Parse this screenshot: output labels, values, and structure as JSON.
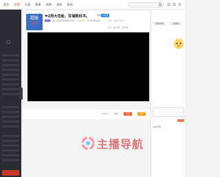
{
  "nav": {
    "items": [
      "首页",
      "直播",
      "分类",
      "赛事",
      "视频",
      "游戏",
      "鱼吧"
    ],
    "active_index": 1
  },
  "search": {
    "placeholder": ""
  },
  "room": {
    "title": "❤2周大花脸，写填数科书。",
    "report_label": "举报",
    "follow_label": "+关注",
    "meta": [
      "宝贝",
      "我心光皇天知府前小孩杆",
      "123.0万",
      "日 京中新主方"
    ],
    "meta2": [
      "♡ 5.9",
      "105.1万人"
    ],
    "subbar": [
      "分享",
      "客户端",
      "手机看"
    ],
    "avatar_lines": [
      "超版",
      "伞中"
    ]
  },
  "player_bar": {
    "left_text": "6.6万人",
    "gift_labels": [
      "分享",
      "送礼"
    ],
    "fans_label": "粉丝"
  },
  "right_panel": {
    "tabs": [
      "贡献周榜",
      "贵宾席"
    ],
    "texts": [
      "",
      ""
    ],
    "bottom_label": "主播声明"
  },
  "watermark": {
    "text": "主播导航"
  },
  "colors": {
    "accent": "#ff5d23",
    "follow": "#2d8cf0",
    "sidebar": "#2b2b33",
    "gift_red": "#ff5722",
    "gift_orange": "#ff9800"
  }
}
